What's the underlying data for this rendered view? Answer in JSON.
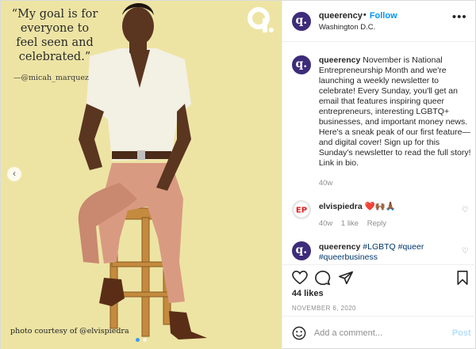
{
  "media": {
    "quote": "“My goal is for everyone to feel seen and celebrated.”",
    "quote_author": "—@micah_marquez",
    "credit": "photo courtesy of @elvispiedra",
    "prev_icon": "‹",
    "slide_count": 2,
    "active_slide": 1,
    "colors": {
      "background": "#ede4a4"
    }
  },
  "header": {
    "avatar_glyph": "q.",
    "username": "queerency",
    "separator": "•",
    "follow_label": "Follow",
    "location": "Washington D.C.",
    "more_icon": "•••"
  },
  "caption": {
    "avatar_glyph": "q.",
    "username": "queerency",
    "text": "November is National Entrepreneurship Month and we're launching a weekly newsletter to celebrate! Every Sunday, you'll get an email that features inspiring queer entrepreneurs, interesting LGBTQ+ businesses, and important money news. Here's a sneak peak of our first feature—and digital cover! Sign up for this Sunday's newsletter to read the full story! Link in bio.",
    "age": "40w"
  },
  "comments": [
    {
      "username": "elvispiedra",
      "text": "❤️🙌🏾🙏🏾",
      "age": "40w",
      "likes": "1 like",
      "reply_label": "Reply"
    },
    {
      "avatar_glyph": "q.",
      "username": "queerency",
      "tags": [
        "#LGBTQ",
        "#queer",
        "#queerbusiness"
      ]
    }
  ],
  "actions": {
    "likes": "44 likes",
    "date": "NOVEMBER 6, 2020"
  },
  "add_comment": {
    "placeholder": "Add a comment...",
    "post_label": "Post"
  }
}
